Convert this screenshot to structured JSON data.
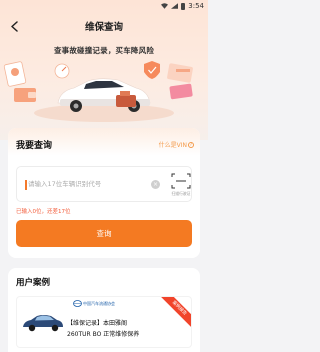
{
  "status_bar": {
    "time": "3:54"
  },
  "nav": {
    "title": "维保查询"
  },
  "banner": {
    "title": "查事故碰撞记录，买车降风险"
  },
  "query": {
    "title": "我要查询",
    "vin_help_label": "什么是VIN",
    "vin_placeholder": "请输入17位车辆识别代号",
    "scan_label": "扫描行驶证",
    "input_hint": "已输入0位，还差17位",
    "submit_label": "查询"
  },
  "cases": {
    "title": "用户案例",
    "items": [
      {
        "logo_text": "中国汽车流通协会",
        "line1": "【维保记录】本田雅阁",
        "line2": "260TUR BO  正常维修保养",
        "ribbon": "案例报告"
      }
    ]
  },
  "colors": {
    "accent": "#f47a22",
    "hint": "#f25c3a",
    "link": "#f39a4a",
    "ribbon": "#f1442b"
  }
}
